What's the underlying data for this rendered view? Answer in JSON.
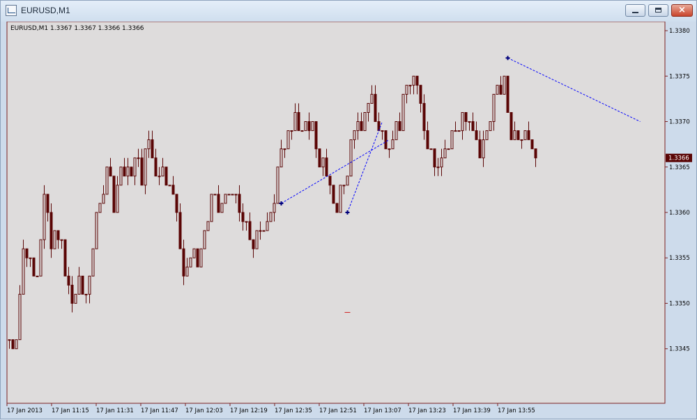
{
  "window": {
    "title": "EURUSD,M1",
    "buttons": {
      "minimize": "minimize",
      "maximize": "maximize",
      "close": "×"
    }
  },
  "colors": {
    "plot_bg": "#dedcdc",
    "frame": "#7a1f1f",
    "candle": "#5a0505",
    "line_object": "#0000ff",
    "marker": "#00007a",
    "price_label_bg": "#5a0505",
    "level_mark": "#d02020"
  },
  "chart_data": {
    "type": "candlestick",
    "symbol_header": "EURUSD,M1  1.3367 1.3367 1.3366 1.3366",
    "current_price": 1.3366,
    "current_price_label": "1.3366",
    "y_axis": {
      "range": [
        1.3339,
        1.3381
      ],
      "ticks": [
        1.338,
        1.3375,
        1.337,
        1.3365,
        1.336,
        1.3355,
        1.335,
        1.3345
      ],
      "tick_labels": [
        "1.3380",
        "1.3375",
        "1.3370",
        "1.3365",
        "1.3360",
        "1.3355",
        "1.3350",
        "1.3345"
      ]
    },
    "x_axis": {
      "tick_labels": [
        "17 Jan 2013",
        "17 Jan 11:15",
        "17 Jan 11:31",
        "17 Jan 11:47",
        "17 Jan 12:03",
        "17 Jan 12:19",
        "17 Jan 12:35",
        "17 Jan 12:51",
        "17 Jan 13:07",
        "17 Jan 13:23",
        "17 Jan 13:39",
        "17 Jan 13:55"
      ]
    },
    "close_path": [
      [
        0,
        1.3346
      ],
      [
        1,
        1.3346
      ],
      [
        2,
        1.3347
      ],
      [
        3,
        1.3351
      ],
      [
        4,
        1.3356
      ],
      [
        6,
        1.3355
      ],
      [
        8,
        1.3354
      ],
      [
        10,
        1.3361
      ],
      [
        12,
        1.3356
      ],
      [
        14,
        1.3358
      ],
      [
        16,
        1.3353
      ],
      [
        18,
        1.335
      ],
      [
        20,
        1.3352
      ],
      [
        22,
        1.3351
      ],
      [
        24,
        1.3357
      ],
      [
        26,
        1.336
      ],
      [
        28,
        1.3366
      ],
      [
        30,
        1.3361
      ],
      [
        32,
        1.3365
      ],
      [
        34,
        1.3364
      ],
      [
        36,
        1.3366
      ],
      [
        38,
        1.3364
      ],
      [
        40,
        1.3368
      ],
      [
        42,
        1.3365
      ],
      [
        44,
        1.3365
      ],
      [
        46,
        1.3364
      ],
      [
        48,
        1.3359
      ],
      [
        50,
        1.3354
      ],
      [
        52,
        1.3355
      ],
      [
        54,
        1.3355
      ],
      [
        56,
        1.3358
      ],
      [
        58,
        1.3361
      ],
      [
        60,
        1.336
      ],
      [
        62,
        1.3361
      ],
      [
        64,
        1.3363
      ],
      [
        66,
        1.3359
      ],
      [
        68,
        1.3358
      ],
      [
        70,
        1.3357
      ],
      [
        72,
        1.3357
      ],
      [
        74,
        1.336
      ],
      [
        76,
        1.3362
      ],
      [
        78,
        1.3366
      ],
      [
        80,
        1.337
      ],
      [
        82,
        1.3371
      ],
      [
        84,
        1.3368
      ],
      [
        86,
        1.337
      ],
      [
        88,
        1.3368
      ],
      [
        90,
        1.3365
      ],
      [
        92,
        1.3362
      ],
      [
        94,
        1.3361
      ],
      [
        96,
        1.3363
      ],
      [
        98,
        1.3367
      ],
      [
        100,
        1.3369
      ],
      [
        102,
        1.3371
      ],
      [
        104,
        1.3373
      ],
      [
        106,
        1.3369
      ],
      [
        108,
        1.3368
      ],
      [
        110,
        1.3369
      ],
      [
        112,
        1.337
      ],
      [
        114,
        1.3374
      ],
      [
        116,
        1.3375
      ],
      [
        118,
        1.3371
      ],
      [
        120,
        1.3368
      ],
      [
        122,
        1.3366
      ],
      [
        124,
        1.3367
      ],
      [
        126,
        1.3367
      ],
      [
        128,
        1.3369
      ],
      [
        130,
        1.3371
      ],
      [
        132,
        1.3369
      ],
      [
        134,
        1.3367
      ],
      [
        136,
        1.3367
      ],
      [
        138,
        1.3371
      ],
      [
        140,
        1.3373
      ],
      [
        142,
        1.3374
      ],
      [
        144,
        1.3369
      ],
      [
        146,
        1.3369
      ],
      [
        148,
        1.337
      ],
      [
        150,
        1.3368
      ],
      [
        151,
        1.3366
      ]
    ],
    "trend_lines": [
      {
        "from": {
          "bar": 78,
          "price": 1.3361
        },
        "to": {
          "bar": 109,
          "price": 1.3368
        }
      },
      {
        "from": {
          "bar": 97,
          "price": 1.336
        },
        "to": {
          "bar": 107,
          "price": 1.337
        }
      },
      {
        "from": {
          "bar": 143,
          "price": 1.3377
        },
        "to": {
          "bar": 181,
          "price": 1.337
        }
      }
    ],
    "markers": [
      {
        "bar": 78,
        "price": 1.3361
      },
      {
        "bar": 97,
        "price": 1.336
      },
      {
        "bar": 143,
        "price": 1.3377
      }
    ],
    "level_marks": [
      {
        "bar": 97,
        "price": 1.3349
      }
    ]
  }
}
